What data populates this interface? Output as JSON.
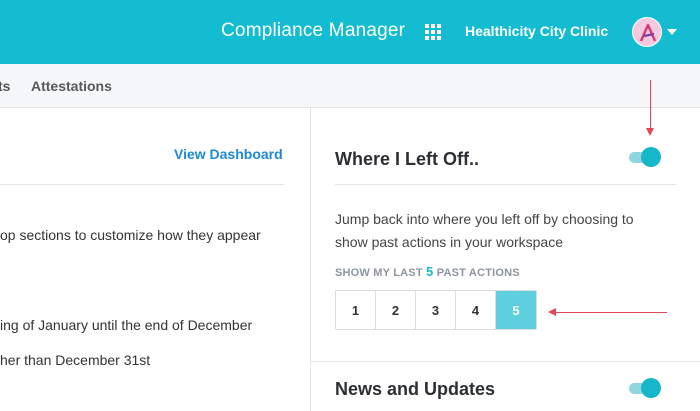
{
  "header": {
    "app_title": "Compliance Manager",
    "apps_icon": "grid-icon",
    "org_name": "Healthicity City Clinic",
    "avatar_icon": "avatar-logo",
    "brand_color": "#13bcd0"
  },
  "subnav": {
    "items": [
      {
        "label": "ts"
      },
      {
        "label": "Attestations"
      }
    ]
  },
  "left_panel": {
    "link_label": "View Dashboard",
    "lines": [
      "op sections to customize how they appear",
      "ing of January until the end of December",
      "her than December 31st"
    ]
  },
  "right_panel": {
    "where_left_off": {
      "title": "Where I Left Off..",
      "toggle_on": true,
      "description": "Jump back into where you left off by choosing to show past actions in your workspace",
      "show_label_prefix": "SHOW MY LAST",
      "show_count": "5",
      "show_label_suffix": "PAST ACTIONS",
      "options": [
        "1",
        "2",
        "3",
        "4",
        "5"
      ],
      "selected": "5"
    },
    "news": {
      "title": "News and Updates",
      "toggle_on": true
    }
  },
  "colors": {
    "accent": "#17b7cb",
    "selected_button": "#5ecfde",
    "annotation_arrow": "#e04858",
    "link": "#1e88d6"
  }
}
